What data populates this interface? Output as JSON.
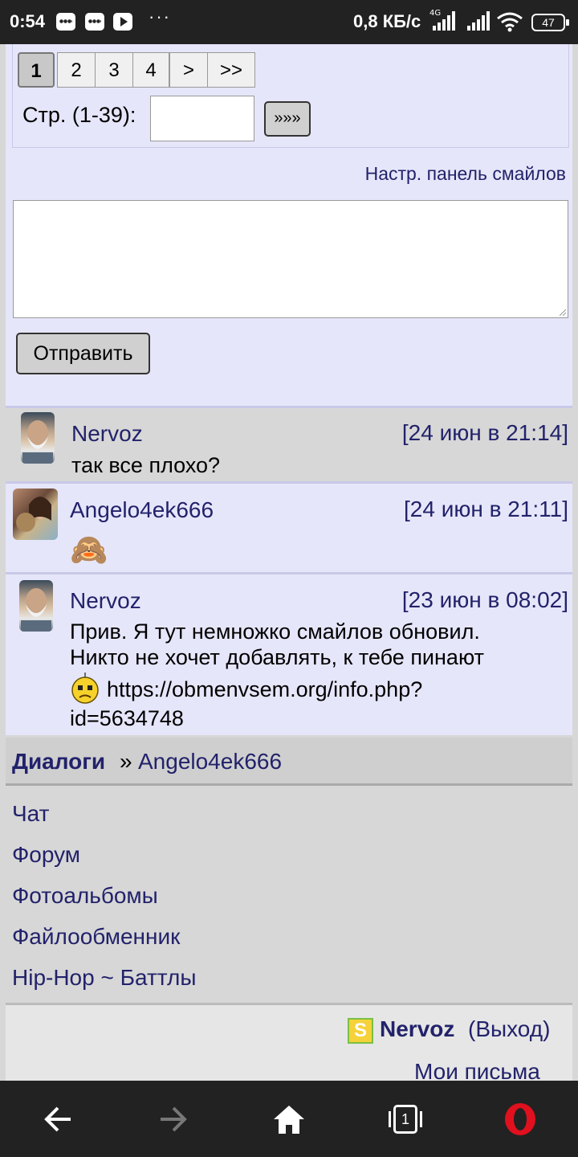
{
  "status_bar": {
    "time": "0:54",
    "dots": "···",
    "network_speed": "0,8 КБ/с",
    "network_type": "4G",
    "battery": "47"
  },
  "pagination": {
    "current": "1",
    "pages": [
      "2",
      "3",
      "4"
    ],
    "next": ">",
    "last": ">>",
    "goto_label": "Стр. (1-39):",
    "goto_value": "",
    "goto_button": "»»»"
  },
  "compose": {
    "smiles_panel_link": "Настр. панель смайлов",
    "message_value": "",
    "send_button": "Отправить"
  },
  "messages": [
    {
      "author": "Nervoz",
      "date": "[24 июн в 21:14]",
      "text": "так все плохо?",
      "bg": "#d7d7d7"
    },
    {
      "author": "Angelo4ek666",
      "date": "[24 июн в 21:11]",
      "text": "",
      "emoji": "🙈",
      "bg": "#e6e6fa"
    },
    {
      "author": "Nervoz",
      "date": "[23 июн в 08:02]",
      "text_line1": "Прив. Я тут немножко смайлов обновил.",
      "text_line2": "Никто не хочет добавлять, к тебе пинают",
      "link_part1": "https://obmenvsem.org/info.php?",
      "link_part2": "id=5634748",
      "bg": "#e6e6fa"
    }
  ],
  "breadcrumb": {
    "root": "Диалоги",
    "sep": "»",
    "current": "Angelo4ek666"
  },
  "menu": [
    "Чат",
    "Форум",
    "Фотоальбомы",
    "Файлообменник",
    "Hip-Hop ~ Баттлы"
  ],
  "footer": {
    "badge": "S",
    "user": "Nervoz",
    "logout": "(Выход)",
    "mail": "Мои письма"
  },
  "nav": {
    "tabs_count": "1"
  },
  "colors": {
    "link": "#22226b",
    "panel": "#e6e6fa",
    "grey": "#d7d7d7"
  }
}
